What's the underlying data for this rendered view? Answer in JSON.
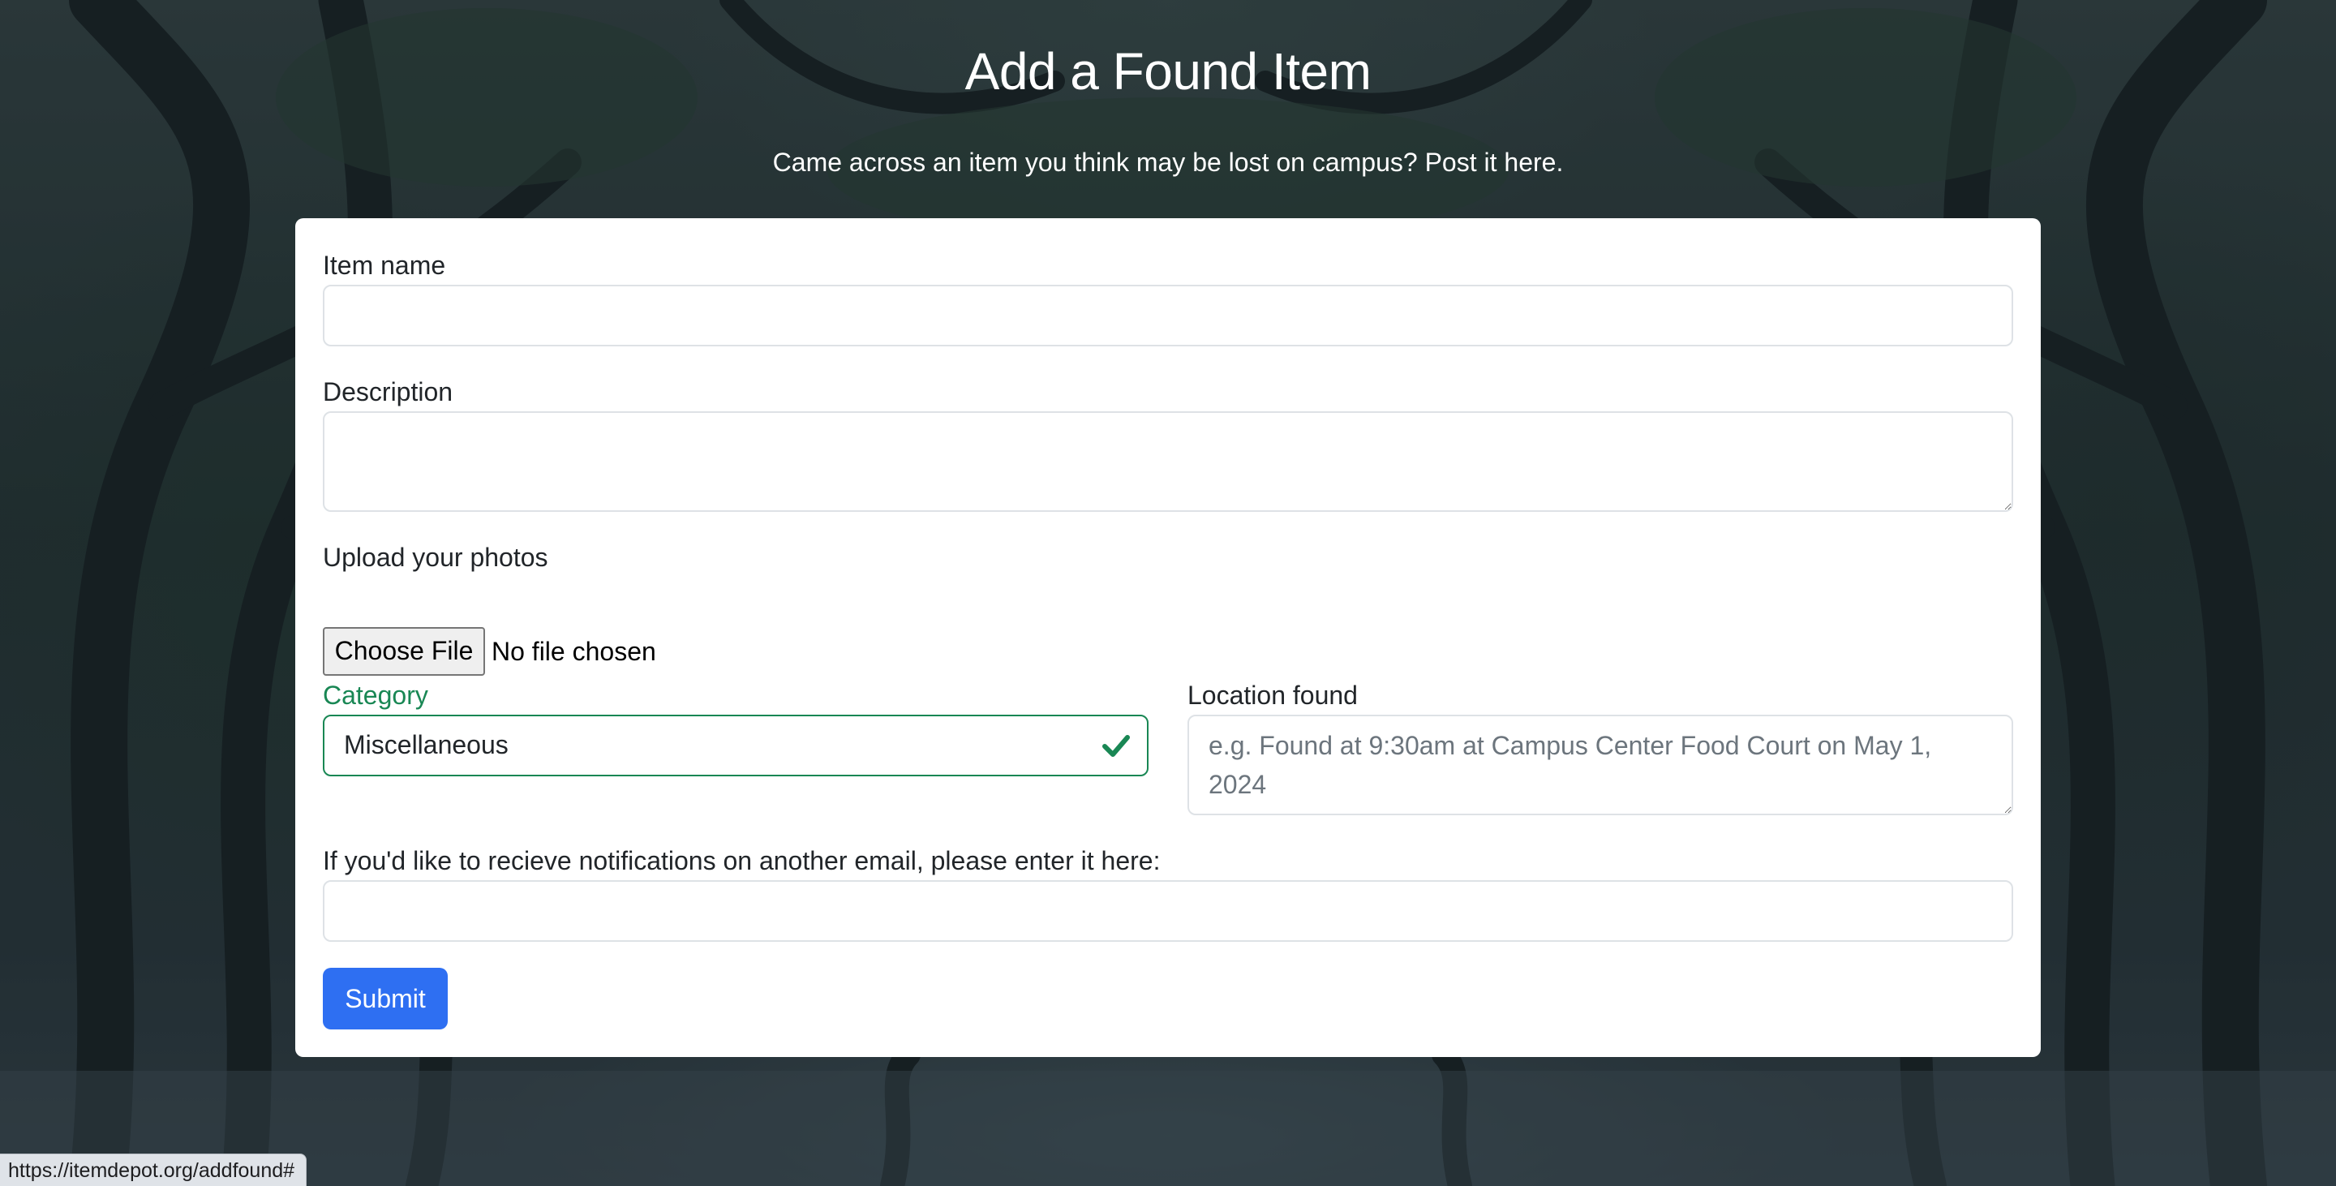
{
  "page": {
    "title": "Add a Found Item",
    "subtitle": "Came across an item you think may be lost on campus? Post it here."
  },
  "form": {
    "item_name": {
      "label": "Item name",
      "value": ""
    },
    "description": {
      "label": "Description",
      "value": ""
    },
    "photos": {
      "label": "Upload your photos",
      "button_label": "Choose File",
      "status": "No file chosen"
    },
    "category": {
      "label": "Category",
      "value": "Miscellaneous",
      "state": "valid"
    },
    "location": {
      "label": "Location found",
      "placeholder": "e.g. Found at 9:30am at Campus Center Food Court on May 1, 2024"
    },
    "email": {
      "label": "If you'd like to recieve notifications on another email, please enter it here:",
      "value": ""
    },
    "submit_label": "Submit"
  },
  "status_bar": {
    "url": "https://itemdepot.org/addfound#"
  },
  "colors": {
    "accent": "#2e6ff2",
    "valid": "#198754",
    "card": "#ffffff"
  },
  "icons": {
    "category_valid": "check-icon",
    "resize": "resize-grip-icon"
  }
}
